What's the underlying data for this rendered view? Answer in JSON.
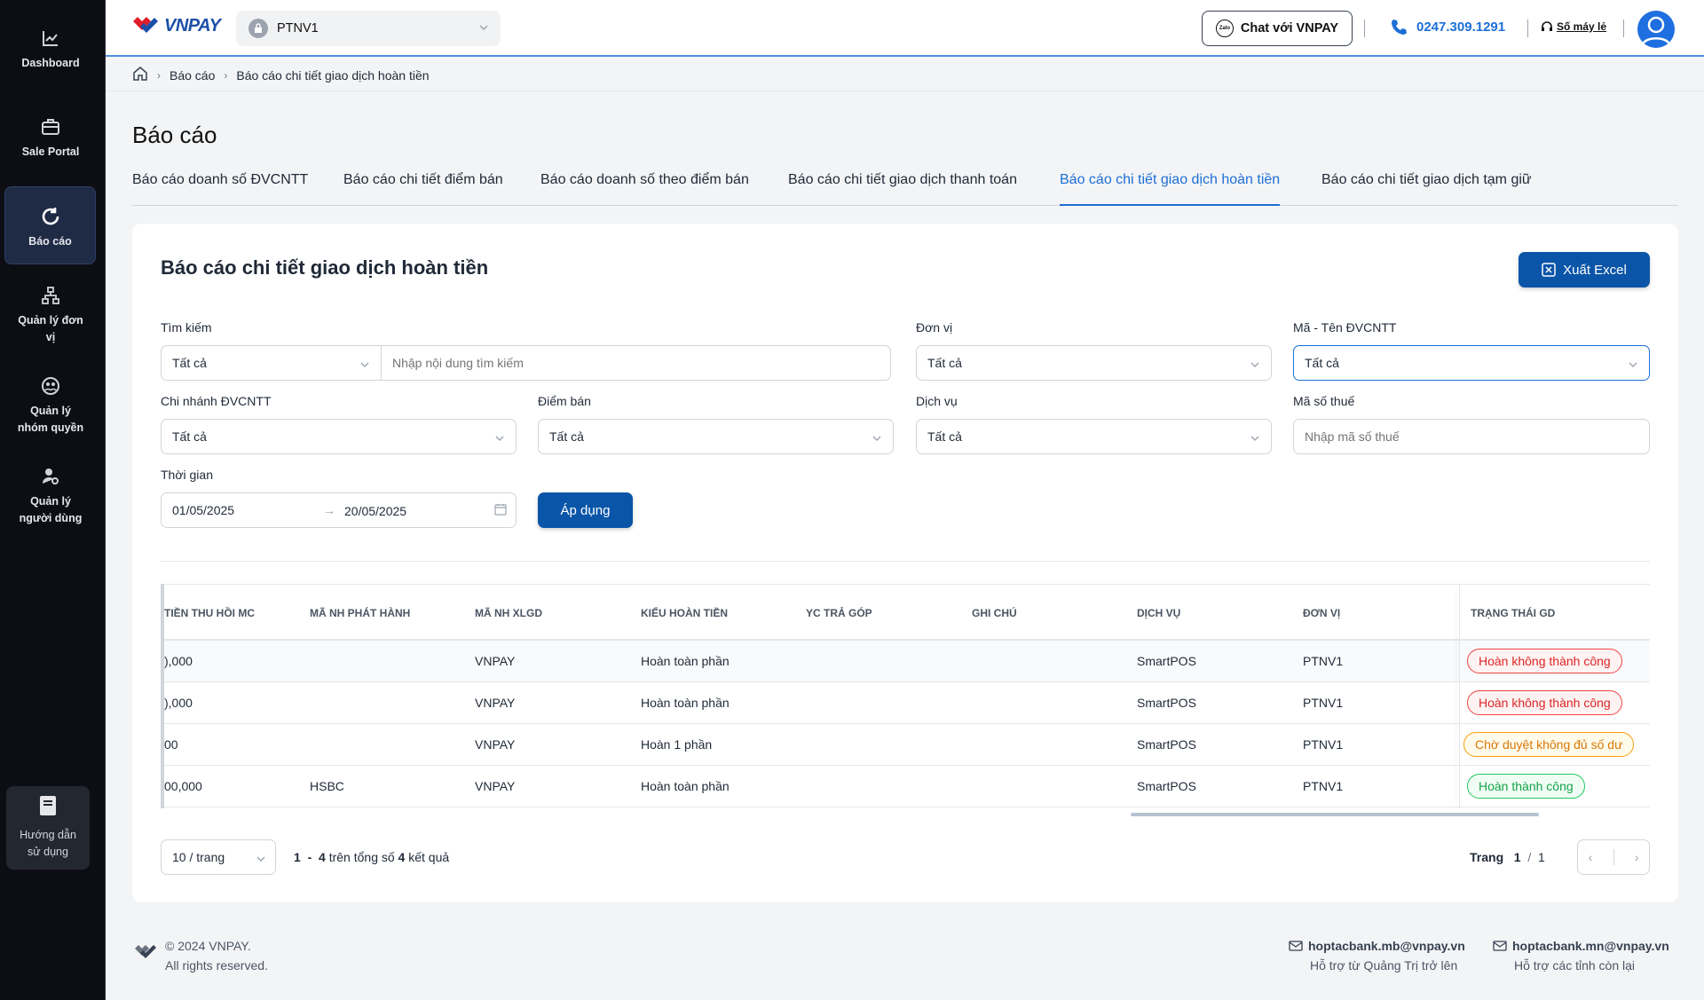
{
  "sidebar": {
    "items": [
      {
        "label": "Dashboard"
      },
      {
        "label": "Sale Portal"
      },
      {
        "label": "Báo cáo"
      },
      {
        "label": "Quản lý đơn vị"
      },
      {
        "label": "Quản lý nhóm quyền"
      },
      {
        "label": "Quản lý người dùng"
      }
    ],
    "guide": "Hướng dẫn sử dụng"
  },
  "header": {
    "logo_text": "VNPAY",
    "unit": "PTNV1",
    "chat": "Chat với VNPAY",
    "zalo": "Zalo",
    "phone": "0247.309.1291",
    "hotline": "Số máy lẻ"
  },
  "breadcrumb": [
    "Báo cáo",
    "Báo cáo chi tiết giao dịch hoàn tiền"
  ],
  "page_title": "Báo cáo",
  "tabs": [
    "Báo cáo doanh số ĐVCNTT",
    "Báo cáo chi tiết điểm bán",
    "Báo cáo doanh số theo điểm bán",
    "Báo cáo chi tiết giao dịch thanh toán",
    "Báo cáo chi tiết giao dịch hoàn tiền",
    "Báo cáo chi tiết giao dịch tạm giữ"
  ],
  "card": {
    "title": "Báo cáo chi tiết giao dịch hoàn tiền",
    "export": "Xuất Excel"
  },
  "filters": {
    "search_label": "Tìm kiếm",
    "search_type": "Tất cả",
    "search_placeholder": "Nhập nội dung tìm kiếm",
    "unit_label": "Đơn vị",
    "unit_value": "Tất cả",
    "merchant_label": "Mã - Tên ĐVCNTT",
    "merchant_value": "Tất cả",
    "branch_label": "Chi nhánh ĐVCNTT",
    "branch_value": "Tất cả",
    "pos_label": "Điểm bán",
    "pos_value": "Tất cả",
    "service_label": "Dịch vụ",
    "service_value": "Tất cả",
    "tax_label": "Mã số thuế",
    "tax_placeholder": "Nhập mã số thuế",
    "time_label": "Thời gian",
    "date_from": "01/05/2025",
    "date_to": "20/05/2025",
    "apply": "Áp dụng"
  },
  "table": {
    "columns": [
      "TIỀN THU HỒI MC",
      "MÃ NH PHÁT HÀNH",
      "MÃ NH XLGD",
      "KIỂU HOÀN TIỀN",
      "YC TRẢ GÓP",
      "GHI CHÚ",
      "DỊCH VỤ",
      "ĐƠN VỊ",
      "TRẠNG THÁI GD"
    ],
    "rows": [
      {
        "recovered": "),000",
        "issuer": "",
        "processor": "VNPAY",
        "refund_type": "Hoàn toàn phần",
        "installment": "",
        "note": "",
        "service": "SmartPOS",
        "unit": "PTNV1",
        "status": "Hoàn không thành công",
        "status_kind": "red"
      },
      {
        "recovered": "),000",
        "issuer": "",
        "processor": "VNPAY",
        "refund_type": "Hoàn toàn phần",
        "installment": "",
        "note": "",
        "service": "SmartPOS",
        "unit": "PTNV1",
        "status": "Hoàn không thành công",
        "status_kind": "red"
      },
      {
        "recovered": "00",
        "issuer": "",
        "processor": "VNPAY",
        "refund_type": "Hoàn 1 phần",
        "installment": "",
        "note": "",
        "service": "SmartPOS",
        "unit": "PTNV1",
        "status": "Chờ duyệt không đủ số dư",
        "status_kind": "orange"
      },
      {
        "recovered": "00,000",
        "issuer": "HSBC",
        "processor": "VNPAY",
        "refund_type": "Hoàn toàn phần",
        "installment": "",
        "note": "",
        "service": "SmartPOS",
        "unit": "PTNV1",
        "status": "Hoàn thành công",
        "status_kind": "green"
      }
    ]
  },
  "pagination": {
    "page_size": "10 / trang",
    "range_from": "1",
    "range_to": "4",
    "total_text": "trên tổng số",
    "total": "4",
    "result_text": "kết quả",
    "page_label": "Trang",
    "current": "1",
    "pages": "1"
  },
  "footer": {
    "copyright": "© 2024 VNPAY.",
    "rights": "All rights reserved.",
    "contacts": [
      {
        "email": "hoptacbank.mb@vnpay.vn",
        "desc": "Hỗ trợ từ Quảng Trị trở lên"
      },
      {
        "email": "hoptacbank.mn@vnpay.vn",
        "desc": "Hỗ trợ các tỉnh còn lại"
      }
    ]
  },
  "colors": {
    "primary": "#0a55a8",
    "accent": "#1d6fd6",
    "sidebar": "#0d0e14"
  }
}
